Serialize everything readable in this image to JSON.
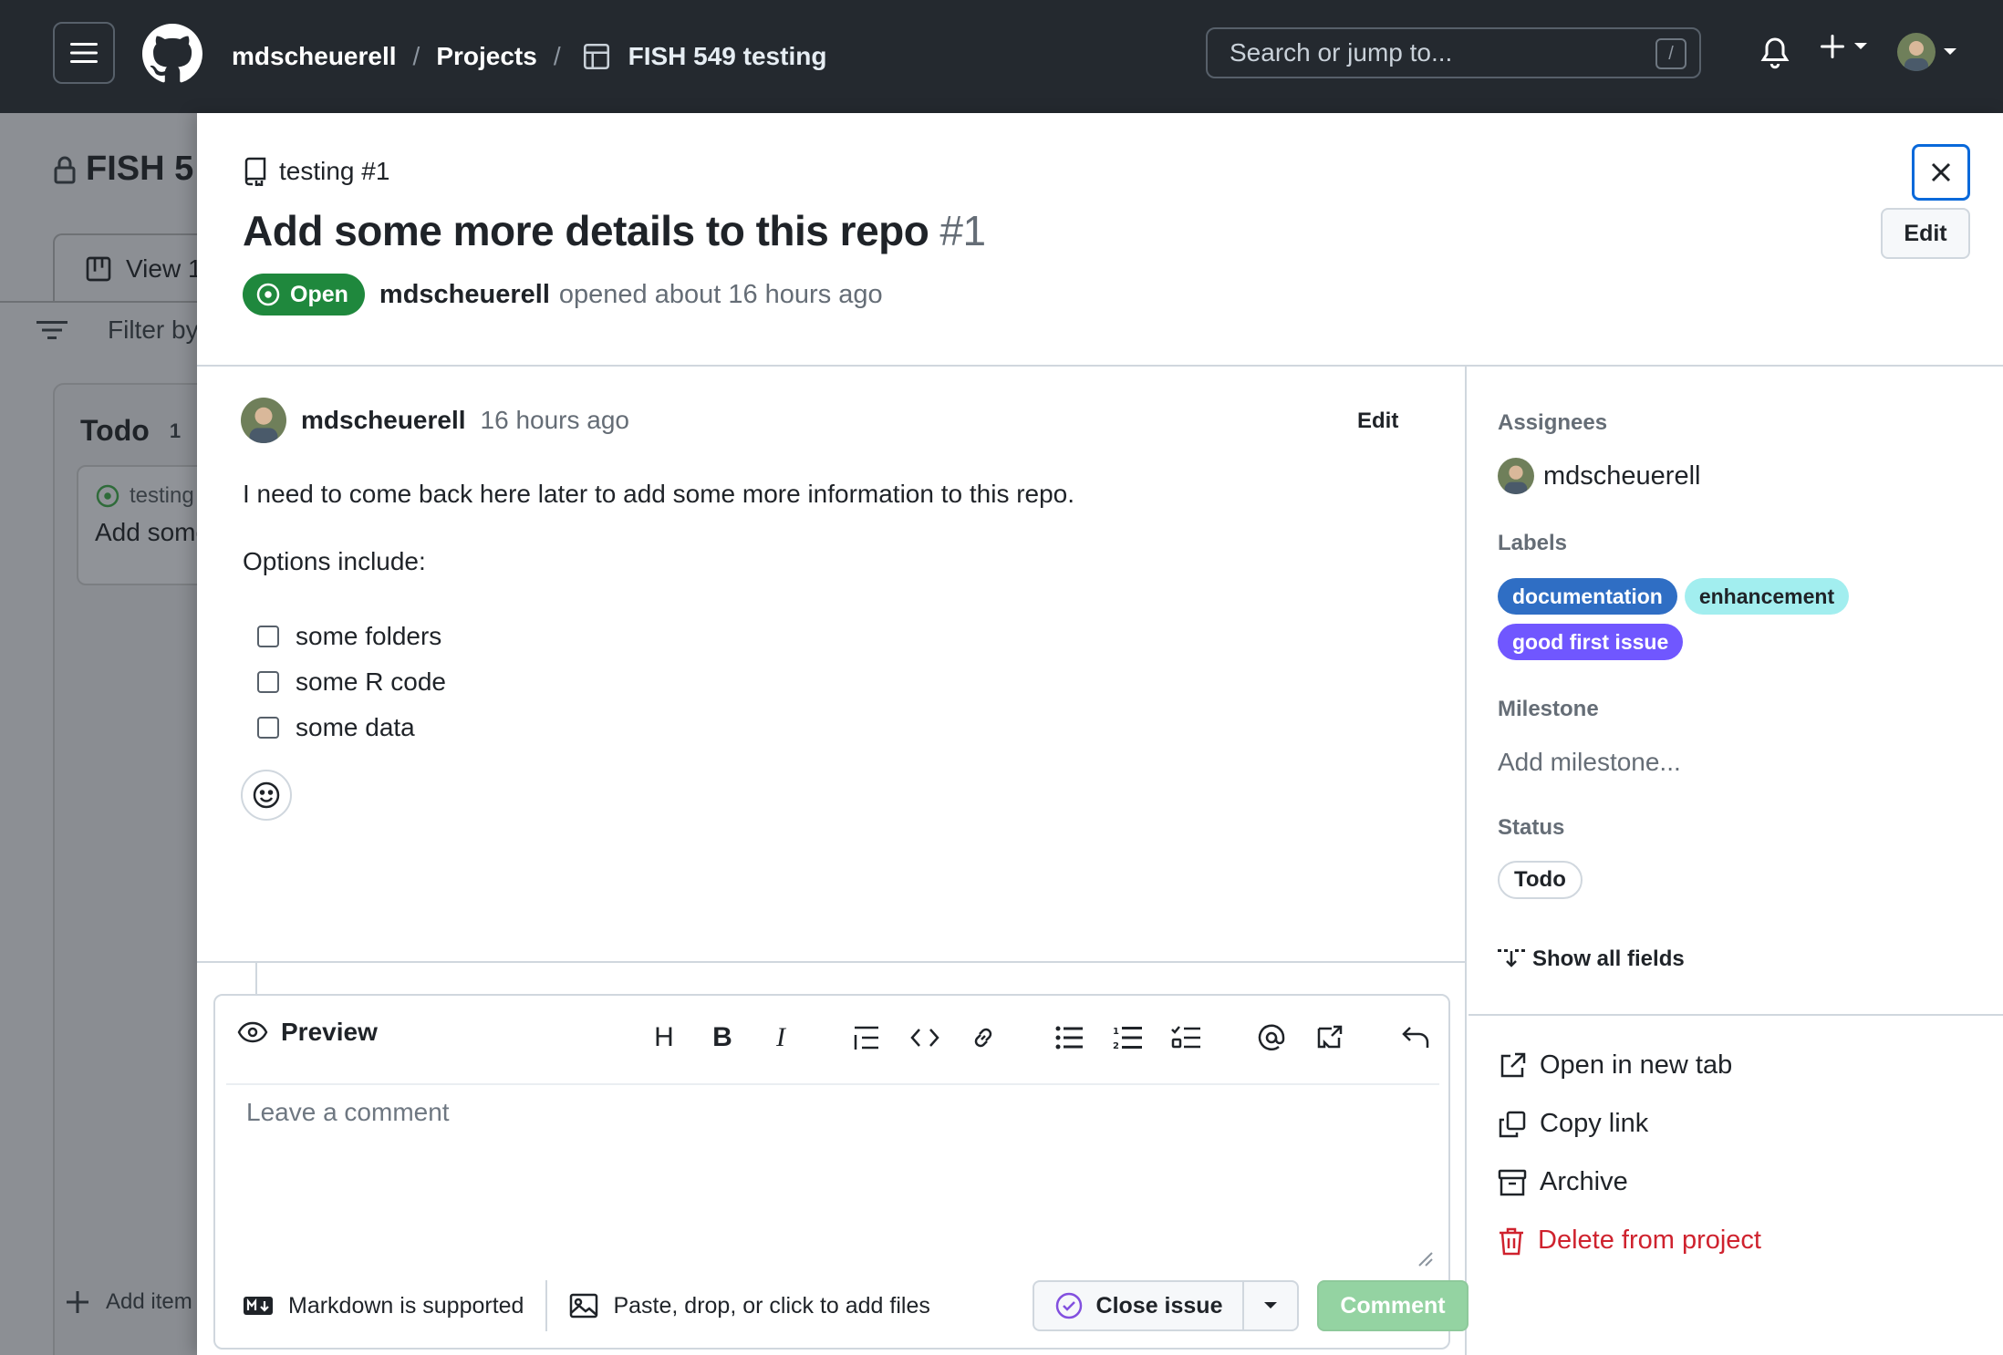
{
  "header": {
    "owner": "mdscheuerell",
    "projects": "Projects",
    "project_name": "FISH 549 testing",
    "search_placeholder": "Search or jump to...",
    "search_shortcut": "/"
  },
  "background": {
    "project_title": "FISH 5",
    "view_tab": "View 1",
    "filter_placeholder": "Filter by",
    "column_name": "Todo",
    "column_count": "1",
    "card_ref": "testing",
    "card_title": "Add some",
    "add_item": "Add item"
  },
  "issue": {
    "repo_ref": "testing #1",
    "title": "Add some more details to this repo",
    "number": "#1",
    "state": "Open",
    "author": "mdscheuerell",
    "opened_text": "opened about 16 hours ago",
    "edit_label": "Edit"
  },
  "comment": {
    "author": "mdscheuerell",
    "time": "16 hours ago",
    "edit_label": "Edit",
    "body_line1": "I need to come back here later to add some more information to this repo.",
    "body_line2": "Options include:",
    "tasks": [
      "some folders",
      "some R code",
      "some data"
    ]
  },
  "editor": {
    "tab": "Preview",
    "placeholder": "Leave a comment",
    "markdown_note": "Markdown is supported",
    "attach_note": "Paste, drop, or click to add files",
    "close_issue": "Close issue",
    "comment_button": "Comment",
    "tools": [
      "heading",
      "bold",
      "italic",
      "quote",
      "code",
      "link",
      "bulleted-list",
      "numbered-list",
      "task-list",
      "mention",
      "reference",
      "undo"
    ]
  },
  "sidebar": {
    "assignees_label": "Assignees",
    "assignee": "mdscheuerell",
    "labels_label": "Labels",
    "labels": [
      {
        "name": "documentation",
        "bg": "#2f6ec4",
        "fg": "#ffffff"
      },
      {
        "name": "enhancement",
        "bg": "#a2eeef",
        "fg": "#1f2328"
      },
      {
        "name": "good first issue",
        "bg": "#7057ff",
        "fg": "#ffffff"
      }
    ],
    "milestone_label": "Milestone",
    "milestone_value": "Add milestone...",
    "status_label": "Status",
    "status_value": "Todo",
    "show_all_fields": "Show all fields",
    "actions": {
      "open_new_tab": "Open in new tab",
      "copy_link": "Copy link",
      "archive": "Archive",
      "delete": "Delete from project"
    }
  },
  "colors": {
    "header_bg": "#24292f",
    "open_green": "#1f883d",
    "focus_blue": "#0969da",
    "danger_red": "#cf222e",
    "comment_btn_disabled": "#94d3a2"
  }
}
